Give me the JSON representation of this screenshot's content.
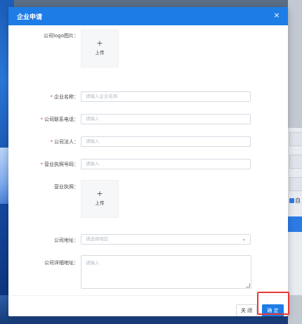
{
  "modal": {
    "title": "企业申请",
    "close_icon": "×"
  },
  "form": {
    "logo_label": "公司logo图片：",
    "logo_upload_plus": "+",
    "logo_upload_text": "上传",
    "company_name": {
      "required_mark": "*",
      "label": "企业名称：",
      "placeholder": "请输入企业名称"
    },
    "phone": {
      "required_mark": "*",
      "label": "公司联系电话：",
      "placeholder": "请输入"
    },
    "legal_person": {
      "required_mark": "*",
      "label": "公司法人：",
      "placeholder": "请输入"
    },
    "license_no": {
      "required_mark": "*",
      "label": "营业执照号码：",
      "placeholder": "请输入"
    },
    "license_label": "营业执照：",
    "license_upload_plus": "+",
    "license_upload_text": "上传",
    "address": {
      "label": "公司地址：",
      "placeholder": "请选择地区",
      "chevron_icon": "⌄"
    },
    "detail_address": {
      "label": "公司详细地址：",
      "placeholder": "请输入"
    }
  },
  "footer": {
    "close_label": "关 闭",
    "confirm_label": "确 定"
  },
  "background": {
    "checkbox_label": "自"
  },
  "colors": {
    "primary": "#1e7ce6",
    "required": "#e23b3b",
    "highlight": "#e53935"
  }
}
